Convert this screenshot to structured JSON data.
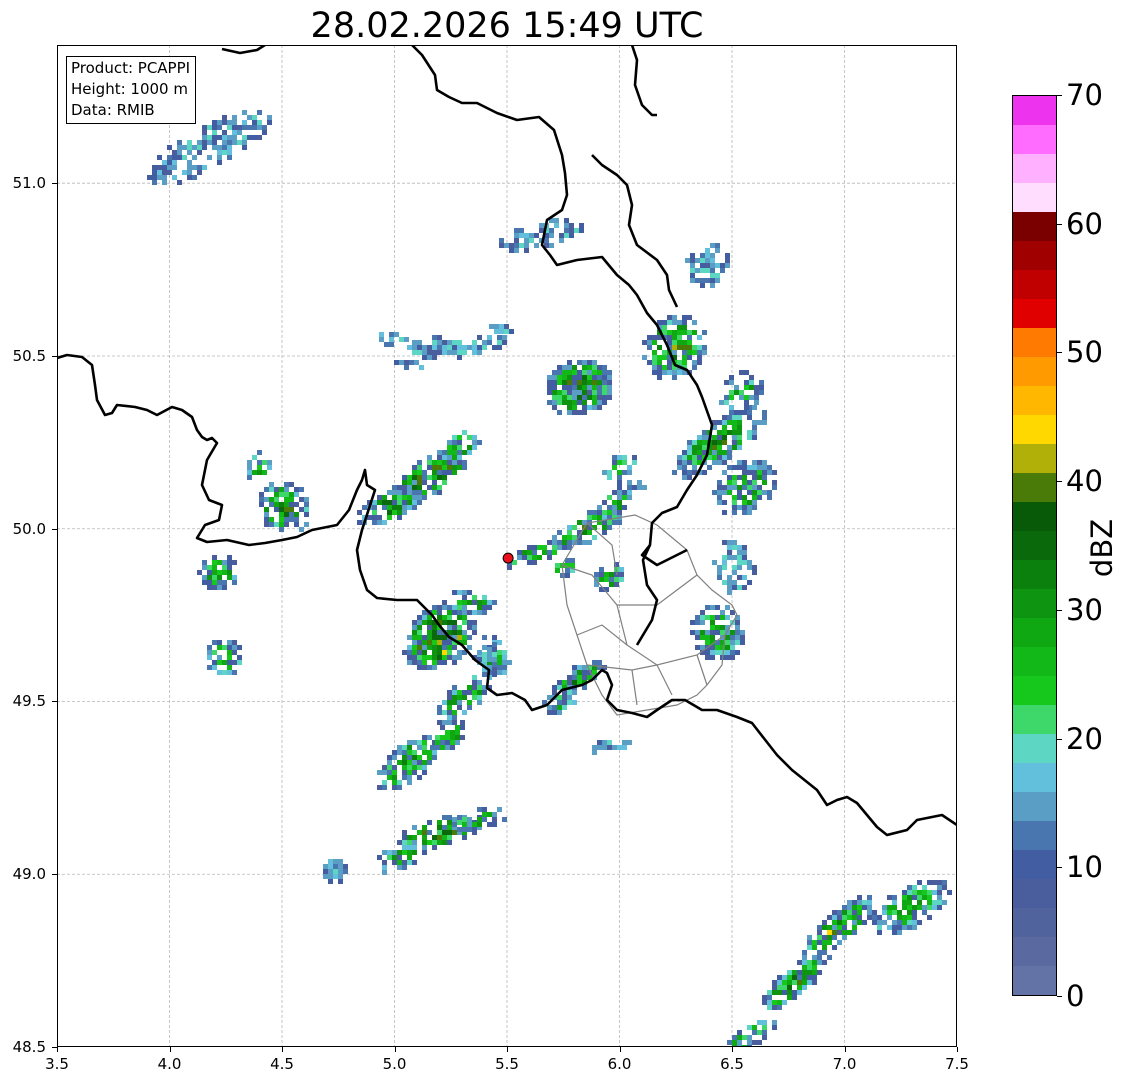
{
  "title": "28.02.2026 15:49 UTC",
  "info_box": {
    "product": "Product: PCAPPI",
    "height": "Height: 1000 m",
    "source": "Data: RMIB"
  },
  "map": {
    "extent": {
      "lon": [
        3.5,
        7.5
      ],
      "lat": [
        48.5,
        51.4
      ]
    },
    "x_ticks": [
      "3.5",
      "4.0",
      "4.5",
      "5.0",
      "5.5",
      "6.0",
      "6.5",
      "7.0",
      "7.5"
    ],
    "y_ticks": [
      "48.5",
      "49.0",
      "49.5",
      "50.0",
      "50.5",
      "51.0"
    ],
    "grid": "dotted",
    "radar_site": {
      "lon": 5.505,
      "lat": 49.915,
      "color": "#e8101a"
    }
  },
  "colorbar": {
    "unit": "dBZ",
    "range": [
      0,
      70
    ],
    "labels": [
      "0",
      "10",
      "20",
      "30",
      "40",
      "50",
      "60",
      "70"
    ],
    "colors": [
      "#6473a6",
      "#5a6aa0",
      "#51639c",
      "#4a5e9e",
      "#425da2",
      "#4a76b0",
      "#5a9ec6",
      "#62c0dc",
      "#5dd6c3",
      "#3ed86a",
      "#16c81c",
      "#12b818",
      "#10a812",
      "#0e9410",
      "#0b800d",
      "#0a6a0b",
      "#085a09",
      "#4a7a08",
      "#b0b008",
      "#ffd800",
      "#ffb700",
      "#ff9a00",
      "#ff7a00",
      "#e00000",
      "#c00000",
      "#a00000",
      "#7a0000",
      "#ffddff",
      "#ffb0ff",
      "#ff6cff",
      "#ee33ee"
    ]
  }
}
